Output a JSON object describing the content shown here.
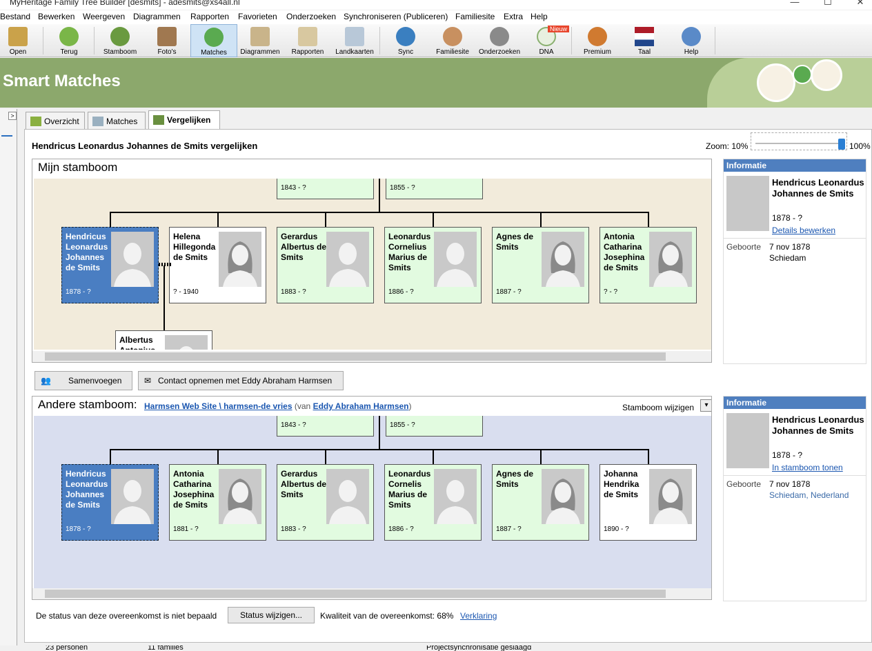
{
  "window": {
    "title": "MyHeritage Family Tree Builder [desmits] - adesmits@xs4all.nl",
    "min": "—",
    "max": "☐",
    "close": "✕"
  },
  "menu": [
    "Bestand",
    "Bewerken",
    "Weergeven",
    "Diagrammen",
    "Rapporten",
    "Favorieten",
    "Onderzoeken",
    "Synchroniseren (Publiceren)",
    "Familiesite",
    "Extra",
    "Help"
  ],
  "toolbar": [
    "Open",
    "Terug",
    "Stamboom",
    "Foto's",
    "Matches",
    "Diagrammen",
    "Rapporten",
    "Landkaarten",
    "Sync",
    "Familiesite",
    "Onderzoeken",
    "DNA",
    "Premium",
    "Taal",
    "Help"
  ],
  "dna_badge": "Nieuw",
  "header_title": "Smart Matches",
  "left_toggle": ">",
  "tabs": [
    "Overzicht",
    "Matches",
    "Vergelijken"
  ],
  "compare_title": "Hendricus Leonardus Johannes de Smits vergelijken",
  "zoom": {
    "label": "Zoom: 10%",
    "max": "100%",
    "value": 100
  },
  "mine": {
    "title": "Mijn stamboom",
    "parents": [
      "1843 - ?",
      "1855 - ?"
    ],
    "people": [
      {
        "name": "Hendricus Leonardus Johannes de Smits",
        "dates": "1878 - ?",
        "type": "selp",
        "sex": "m"
      },
      {
        "name": "Helena Hillegonda de Smits",
        "dates": "? - 1940",
        "type": "white",
        "sex": "f"
      },
      {
        "name": "Gerardus Albertus de Smits",
        "dates": "1883 - ?",
        "type": "green",
        "sex": "m"
      },
      {
        "name": "Leonardus Cornelius Marius de Smits",
        "dates": "1886 - ?",
        "type": "green",
        "sex": "m"
      },
      {
        "name": "Agnes de Smits",
        "dates": "1887 - ?",
        "type": "green",
        "sex": "f"
      },
      {
        "name": "Antonia Catharina Josephina de Smits",
        "dates": "? - ?",
        "type": "green",
        "sex": "f"
      }
    ],
    "child": "Albertus Antonius"
  },
  "info1": {
    "header": "Informatie",
    "name": "Hendricus Leonardus Johannes de Smits",
    "dates": "1878 - ?",
    "link": "Details bewerken",
    "birth_label": "Geboorte",
    "birth_date": "7 nov 1878",
    "birth_place": "Schiedam"
  },
  "buttons": {
    "merge": "Samenvoegen",
    "contact": "Contact opnemen met Eddy Abraham Harmsen"
  },
  "other": {
    "title": "Andere stamboom:",
    "site": "Harmsen Web Site \\ harmsen-de vries",
    "by_pre": "(van",
    "owner": "Eddy Abraham Harmsen",
    "by_post": ")",
    "change": "Stamboom wijzigen",
    "parents": [
      "1843 - ?",
      "1855 - ?"
    ],
    "people": [
      {
        "name": "Hendricus Leonardus Johannes de Smits",
        "dates": "1878 - ?",
        "type": "selp",
        "sex": "m"
      },
      {
        "name": "Antonia Catharina Josephina de Smits",
        "dates": "1881 - ?",
        "type": "green",
        "sex": "f"
      },
      {
        "name": "Gerardus Albertus de Smits",
        "dates": "1883 - ?",
        "type": "green",
        "sex": "m"
      },
      {
        "name": "Leonardus Cornelis Marius de Smits",
        "dates": "1886 - ?",
        "type": "green",
        "sex": "m"
      },
      {
        "name": "Agnes de Smits",
        "dates": "1887 - ?",
        "type": "green",
        "sex": "f"
      },
      {
        "name": "Johanna Hendrika de Smits",
        "dates": "1890 - ?",
        "type": "white",
        "sex": "f"
      }
    ]
  },
  "info2": {
    "header": "Informatie",
    "name": "Hendricus Leonardus Johannes de Smits",
    "dates": "1878 - ?",
    "link": "In stamboom tonen",
    "birth_label": "Geboorte",
    "birth_date": "7 nov 1878",
    "birth_place": "Schiedam, Nederland"
  },
  "footer": {
    "status": "De status van deze overeenkomst is niet bepaald",
    "status_btn": "Status wijzigen...",
    "quality": "Kwaliteit van de overeenkomst: 68%",
    "explain": "Verklaring"
  },
  "statusbar": [
    "23 personen",
    "11 families",
    "Projectsynchronisatie geslaagd"
  ]
}
